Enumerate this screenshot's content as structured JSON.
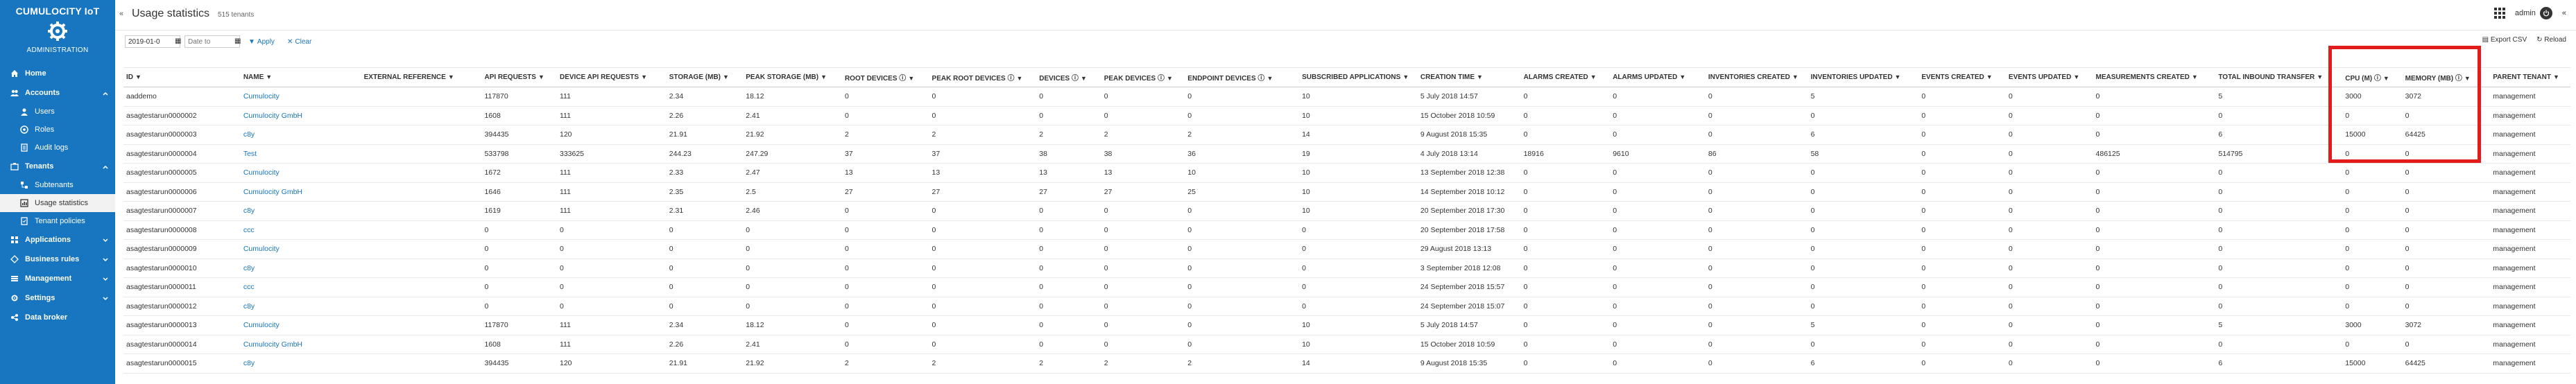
{
  "sidebar": {
    "brand_title": "CUMULOCITY IoT",
    "brand_sub": "ADMINISTRATION",
    "items": [
      {
        "label": "Home",
        "icon": "home-icon"
      },
      {
        "label": "Accounts",
        "icon": "users-icon"
      },
      {
        "label": "Users",
        "icon": "user-icon"
      },
      {
        "label": "Roles",
        "icon": "roles-icon"
      },
      {
        "label": "Audit logs",
        "icon": "logs-icon"
      },
      {
        "label": "Tenants",
        "icon": "tenants-icon"
      },
      {
        "label": "Subtenants",
        "icon": "subtenants-icon"
      },
      {
        "label": "Usage statistics",
        "icon": "stats-icon"
      },
      {
        "label": "Tenant policies",
        "icon": "policy-icon"
      },
      {
        "label": "Applications",
        "icon": "apps-icon"
      },
      {
        "label": "Business rules",
        "icon": "rules-icon"
      },
      {
        "label": "Management",
        "icon": "management-icon"
      },
      {
        "label": "Settings",
        "icon": "settings-icon"
      },
      {
        "label": "Data broker",
        "icon": "broker-icon"
      }
    ]
  },
  "header": {
    "collapse": "«",
    "title": "Usage statistics",
    "tenant_count": "515 tenants",
    "user": "admin"
  },
  "toolbar": {
    "date_from": "2019-01-0",
    "date_to_placeholder": "Date to",
    "apply": "Apply",
    "clear": "Clear",
    "export": "Export CSV",
    "reload": "Reload"
  },
  "table": {
    "columns": [
      "ID",
      "NAME",
      "EXTERNAL REFERENCE",
      "API REQUESTS",
      "DEVICE API REQUESTS",
      "STORAGE (MB)",
      "PEAK STORAGE (MB)",
      "ROOT DEVICES ⓘ",
      "PEAK ROOT DEVICES ⓘ",
      "DEVICES ⓘ",
      "PEAK DEVICES ⓘ",
      "ENDPOINT DEVICES ⓘ",
      "SUBSCRIBED APPLICATIONS",
      "CREATION TIME",
      "ALARMS CREATED",
      "ALARMS UPDATED",
      "INVENTORIES CREATED",
      "INVENTORIES UPDATED",
      "EVENTS CREATED",
      "EVENTS UPDATED",
      "MEASUREMENTS CREATED",
      "TOTAL INBOUND TRANSFER",
      "CPU (M) ⓘ",
      "MEMORY (MB) ⓘ",
      "PARENT TENANT"
    ],
    "rows": [
      [
        "aaddemo",
        "Cumulocity",
        "",
        "117870",
        "111",
        "2.34",
        "18.12",
        "0",
        "0",
        "0",
        "0",
        "0",
        "10",
        "5 July 2018 14:57",
        "0",
        "0",
        "0",
        "5",
        "0",
        "0",
        "0",
        "5",
        "3000",
        "3072",
        "management"
      ],
      [
        "asagtestarun0000002",
        "Cumulocity GmbH",
        "",
        "1608",
        "111",
        "2.26",
        "2.41",
        "0",
        "0",
        "0",
        "0",
        "0",
        "10",
        "15 October 2018 10:59",
        "0",
        "0",
        "0",
        "0",
        "0",
        "0",
        "0",
        "0",
        "0",
        "0",
        "management"
      ],
      [
        "asagtestarun0000003",
        "c8y",
        "",
        "394435",
        "120",
        "21.91",
        "21.92",
        "2",
        "2",
        "2",
        "2",
        "2",
        "14",
        "9 August 2018 15:35",
        "0",
        "0",
        "0",
        "6",
        "0",
        "0",
        "0",
        "6",
        "15000",
        "64425",
        "management"
      ],
      [
        "asagtestarun0000004",
        "Test",
        "",
        "533798",
        "333625",
        "244.23",
        "247.29",
        "37",
        "37",
        "38",
        "38",
        "36",
        "19",
        "4 July 2018 13:14",
        "18916",
        "9610",
        "86",
        "58",
        "0",
        "0",
        "486125",
        "514795",
        "0",
        "0",
        "management"
      ],
      [
        "asagtestarun0000005",
        "Cumulocity",
        "",
        "1672",
        "111",
        "2.33",
        "2.47",
        "13",
        "13",
        "13",
        "13",
        "10",
        "10",
        "13 September 2018 12:38",
        "0",
        "0",
        "0",
        "0",
        "0",
        "0",
        "0",
        "0",
        "0",
        "0",
        "management"
      ],
      [
        "asagtestarun0000006",
        "Cumulocity GmbH",
        "",
        "1646",
        "111",
        "2.35",
        "2.5",
        "27",
        "27",
        "27",
        "27",
        "25",
        "10",
        "14 September 2018 10:12",
        "0",
        "0",
        "0",
        "0",
        "0",
        "0",
        "0",
        "0",
        "0",
        "0",
        "management"
      ],
      [
        "asagtestarun0000007",
        "c8y",
        "",
        "1619",
        "111",
        "2.31",
        "2.46",
        "0",
        "0",
        "0",
        "0",
        "0",
        "10",
        "20 September 2018 17:30",
        "0",
        "0",
        "0",
        "0",
        "0",
        "0",
        "0",
        "0",
        "0",
        "0",
        "management"
      ],
      [
        "asagtestarun0000008",
        "ccc",
        "",
        "0",
        "0",
        "0",
        "0",
        "0",
        "0",
        "0",
        "0",
        "0",
        "0",
        "20 September 2018 17:58",
        "0",
        "0",
        "0",
        "0",
        "0",
        "0",
        "0",
        "0",
        "0",
        "0",
        "management"
      ],
      [
        "asagtestarun0000009",
        "Cumulocity",
        "",
        "0",
        "0",
        "0",
        "0",
        "0",
        "0",
        "0",
        "0",
        "0",
        "0",
        "29 August 2018 13:13",
        "0",
        "0",
        "0",
        "0",
        "0",
        "0",
        "0",
        "0",
        "0",
        "0",
        "management"
      ],
      [
        "asagtestarun0000010",
        "c8y",
        "",
        "0",
        "0",
        "0",
        "0",
        "0",
        "0",
        "0",
        "0",
        "0",
        "0",
        "3 September 2018 12:08",
        "0",
        "0",
        "0",
        "0",
        "0",
        "0",
        "0",
        "0",
        "0",
        "0",
        "management"
      ],
      [
        "asagtestarun0000011",
        "ccc",
        "",
        "0",
        "0",
        "0",
        "0",
        "0",
        "0",
        "0",
        "0",
        "0",
        "0",
        "24 September 2018 15:57",
        "0",
        "0",
        "0",
        "0",
        "0",
        "0",
        "0",
        "0",
        "0",
        "0",
        "management"
      ],
      [
        "asagtestarun0000012",
        "c8y",
        "",
        "0",
        "0",
        "0",
        "0",
        "0",
        "0",
        "0",
        "0",
        "0",
        "0",
        "24 September 2018 15:07",
        "0",
        "0",
        "0",
        "0",
        "0",
        "0",
        "0",
        "0",
        "0",
        "0",
        "management"
      ],
      [
        "asagtestarun0000013",
        "Cumulocity",
        "",
        "117870",
        "111",
        "2.34",
        "18.12",
        "0",
        "0",
        "0",
        "0",
        "0",
        "10",
        "5 July 2018 14:57",
        "0",
        "0",
        "0",
        "5",
        "0",
        "0",
        "0",
        "5",
        "3000",
        "3072",
        "management"
      ],
      [
        "asagtestarun0000014",
        "Cumulocity GmbH",
        "",
        "1608",
        "111",
        "2.26",
        "2.41",
        "0",
        "0",
        "0",
        "0",
        "0",
        "10",
        "15 October 2018 10:59",
        "0",
        "0",
        "0",
        "0",
        "0",
        "0",
        "0",
        "0",
        "0",
        "0",
        "management"
      ],
      [
        "asagtestarun0000015",
        "c8y",
        "",
        "394435",
        "120",
        "21.91",
        "21.92",
        "2",
        "2",
        "2",
        "2",
        "2",
        "14",
        "9 August 2018 15:35",
        "0",
        "0",
        "0",
        "6",
        "0",
        "0",
        "0",
        "6",
        "15000",
        "64425",
        "management"
      ]
    ]
  },
  "colors": {
    "sidebar": "#1776bf",
    "link": "#1776bf",
    "highlight": "#e21b1b"
  }
}
